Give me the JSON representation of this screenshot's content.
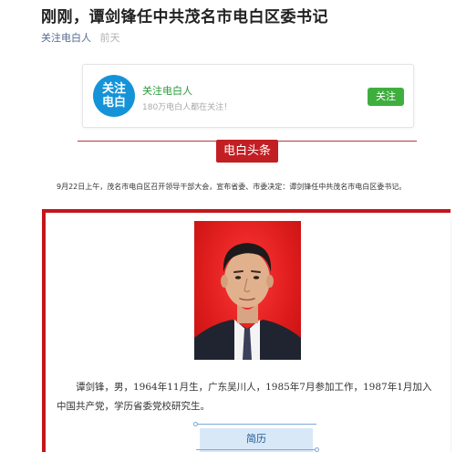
{
  "article": {
    "title": "刚刚，谭剑锋任中共茂名市电白区委书记",
    "account": "关注电白人",
    "time": "前天"
  },
  "follow_card": {
    "logo_line1": "关注",
    "logo_line2": "电白",
    "name": "关注电白人",
    "subtitle": "180万电白人都在关注！",
    "button_label": "关注"
  },
  "section": {
    "tag": "电白头条"
  },
  "lead": "9月22日上午，茂名市电白区召开领导干部大会，宣布省委、市委决定：谭剑锋任中共茂名市电白区委书记。",
  "bio": "谭剑锋，男，1964年11月生，广东吴川人，1985年7月参加工作，1987年1月加入中国共产党，学历省委党校研究生。",
  "resume_tab": "简历",
  "colors": {
    "title": "#222222",
    "account_link": "#576b95",
    "follow_green": "#3eaf3f",
    "logo_blue": "#1493d8",
    "brand_red": "#c4161c",
    "resume_blue": "#d8e8f7"
  }
}
